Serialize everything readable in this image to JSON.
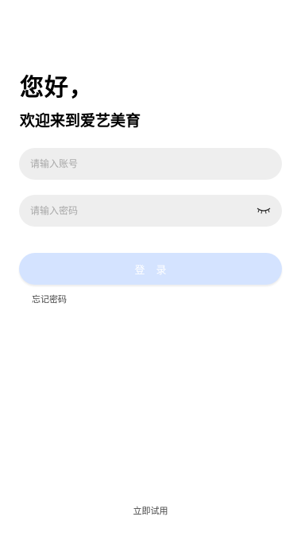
{
  "header": {
    "greeting": "您好，",
    "welcome": "欢迎来到爱艺美育"
  },
  "form": {
    "account_placeholder": "请输入账号",
    "password_placeholder": "请输入密码",
    "password_toggle_icon": "closed-eye-icon",
    "login_label": "登录",
    "forgot_label": "忘记密码"
  },
  "footer": {
    "trial_label": "立即试用"
  },
  "colors": {
    "input_bg": "#eeeeee",
    "login_button_bg": "#d4e3ff",
    "placeholder": "#a8a8a8"
  }
}
